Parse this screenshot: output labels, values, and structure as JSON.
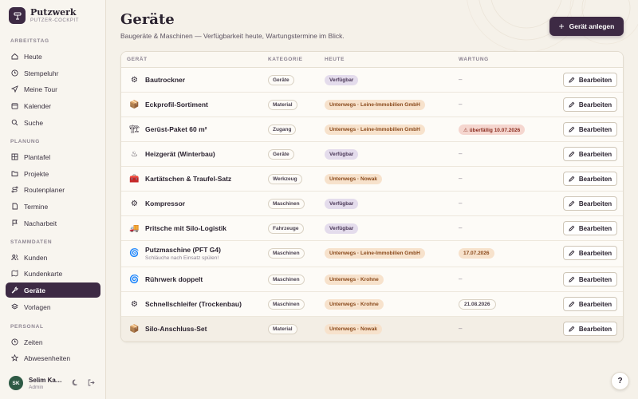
{
  "brand": {
    "name": "Putzwerk",
    "subtitle": "PUTZER-COCKPIT"
  },
  "sidebar": {
    "sections": [
      {
        "label": "ARBEITSTAG",
        "items": [
          {
            "label": "Heute",
            "icon": "home-icon"
          },
          {
            "label": "Stempeluhr",
            "icon": "clock-icon"
          },
          {
            "label": "Meine Tour",
            "icon": "navigation-icon"
          },
          {
            "label": "Kalender",
            "icon": "calendar-icon"
          },
          {
            "label": "Suche",
            "icon": "search-icon"
          }
        ]
      },
      {
        "label": "PLANUNG",
        "items": [
          {
            "label": "Plantafel",
            "icon": "grid-icon"
          },
          {
            "label": "Projekte",
            "icon": "folder-icon"
          },
          {
            "label": "Routenplaner",
            "icon": "route-icon"
          },
          {
            "label": "Termine",
            "icon": "document-icon"
          },
          {
            "label": "Nacharbeit",
            "icon": "flag-icon"
          }
        ]
      },
      {
        "label": "STAMMDATEN",
        "items": [
          {
            "label": "Kunden",
            "icon": "users-icon"
          },
          {
            "label": "Kundenkarte",
            "icon": "map-icon"
          },
          {
            "label": "Geräte",
            "icon": "wrench-icon",
            "active": true
          },
          {
            "label": "Vorlagen",
            "icon": "layers-icon"
          }
        ]
      },
      {
        "label": "PERSONAL",
        "items": [
          {
            "label": "Zeiten",
            "icon": "clock-icon"
          },
          {
            "label": "Abwesenheiten",
            "icon": "star-icon"
          }
        ]
      }
    ]
  },
  "user": {
    "initials": "SK",
    "name": "Selim Ka…",
    "role": "Admin"
  },
  "page": {
    "title": "Geräte",
    "subtitle": "Baugeräte & Maschinen — Verfügbarkeit heute, Wartungstermine im Blick.",
    "add_button": "Gerät anlegen"
  },
  "table": {
    "headers": {
      "device": "GERÄT",
      "category": "KATEGORIE",
      "today": "HEUTE",
      "maintenance": "WARTUNG"
    },
    "edit_label": "Bearbeiten",
    "rows": [
      {
        "icon": "dehumidifier-icon",
        "glyph": "⚙",
        "name": "Bautrockner",
        "category": "Geräte",
        "status": "Verfügbar",
        "status_type": "ok",
        "maintenance": "–",
        "maint_type": "none"
      },
      {
        "icon": "box-icon",
        "glyph": "📦",
        "name": "Eckprofil-Sortiment",
        "category": "Material",
        "status": "Unterwegs · Leine-Immobilien GmbH",
        "status_type": "out",
        "maintenance": "–",
        "maint_type": "none"
      },
      {
        "icon": "scaffold-icon",
        "glyph": "🏗",
        "name": "Gerüst-Paket 60 m²",
        "category": "Zugang",
        "status": "Unterwegs · Leine-Immobilien GmbH",
        "status_type": "out",
        "maintenance": "⚠ überfällig 10.07.2026",
        "maint_type": "over"
      },
      {
        "icon": "heater-icon",
        "glyph": "♨",
        "name": "Heizgerät (Winterbau)",
        "category": "Geräte",
        "status": "Verfügbar",
        "status_type": "ok",
        "maintenance": "–",
        "maint_type": "none"
      },
      {
        "icon": "toolbox-icon",
        "glyph": "🧰",
        "name": "Kartätschen & Traufel-Satz",
        "category": "Werkzeug",
        "status": "Unterwegs · Nowak",
        "status_type": "out",
        "maintenance": "–",
        "maint_type": "none"
      },
      {
        "icon": "compressor-icon",
        "glyph": "⚙",
        "name": "Kompressor",
        "category": "Maschinen",
        "status": "Verfügbar",
        "status_type": "ok",
        "maintenance": "–",
        "maint_type": "none"
      },
      {
        "icon": "truck-icon",
        "glyph": "🚚",
        "name": "Pritsche mit Silo-Logistik",
        "category": "Fahrzeuge",
        "status": "Verfügbar",
        "status_type": "ok",
        "maintenance": "–",
        "maint_type": "none"
      },
      {
        "icon": "spiral-icon",
        "glyph": "🌀",
        "name": "Putzmaschine (PFT G4)",
        "subtext": "Schläuche nach Einsatz spülen!",
        "category": "Maschinen",
        "status": "Unterwegs · Leine-Immobilien GmbH",
        "status_type": "out",
        "maintenance": "17.07.2026",
        "maint_type": "soon"
      },
      {
        "icon": "spiral-icon",
        "glyph": "🌀",
        "name": "Rührwerk doppelt",
        "category": "Maschinen",
        "status": "Unterwegs · Krohne",
        "status_type": "out",
        "maintenance": "–",
        "maint_type": "none"
      },
      {
        "icon": "grinder-icon",
        "glyph": "⚙",
        "name": "Schnellschleifer (Trockenbau)",
        "category": "Maschinen",
        "status": "Unterwegs · Krohne",
        "status_type": "out",
        "maintenance": "21.08.2026",
        "maint_type": "plain"
      },
      {
        "icon": "box-icon",
        "glyph": "📦",
        "name": "Silo-Anschluss-Set",
        "category": "Material",
        "status": "Unterwegs · Nowak",
        "status_type": "out",
        "maintenance": "–",
        "maint_type": "none"
      }
    ]
  },
  "help": {
    "label": "?"
  },
  "colors": {
    "accent": "#3d2a44",
    "background": "#f5f1e9",
    "available": "#e4dcec",
    "away": "#f7e2cc",
    "overdue": "#f5d6cf"
  }
}
